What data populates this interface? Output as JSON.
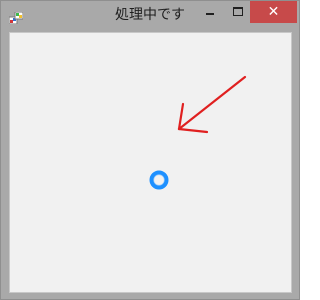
{
  "window": {
    "title": "処理中です",
    "close_glyph": "✕",
    "app_icon": "windows-form-icon",
    "minimize_icon": "minimize-icon",
    "maximize_icon": "maximize-icon",
    "close_icon": "close-icon"
  },
  "content": {
    "spinner_icon": "loading-spinner-icon",
    "arrow_icon": "red-arrow-annotation-icon"
  },
  "colors": {
    "titlebar": "#a9a9a9",
    "close_button": "#c74a4a",
    "client_background": "#f1f1f1",
    "spinner": "#1e90ff",
    "arrow": "#e02020"
  }
}
